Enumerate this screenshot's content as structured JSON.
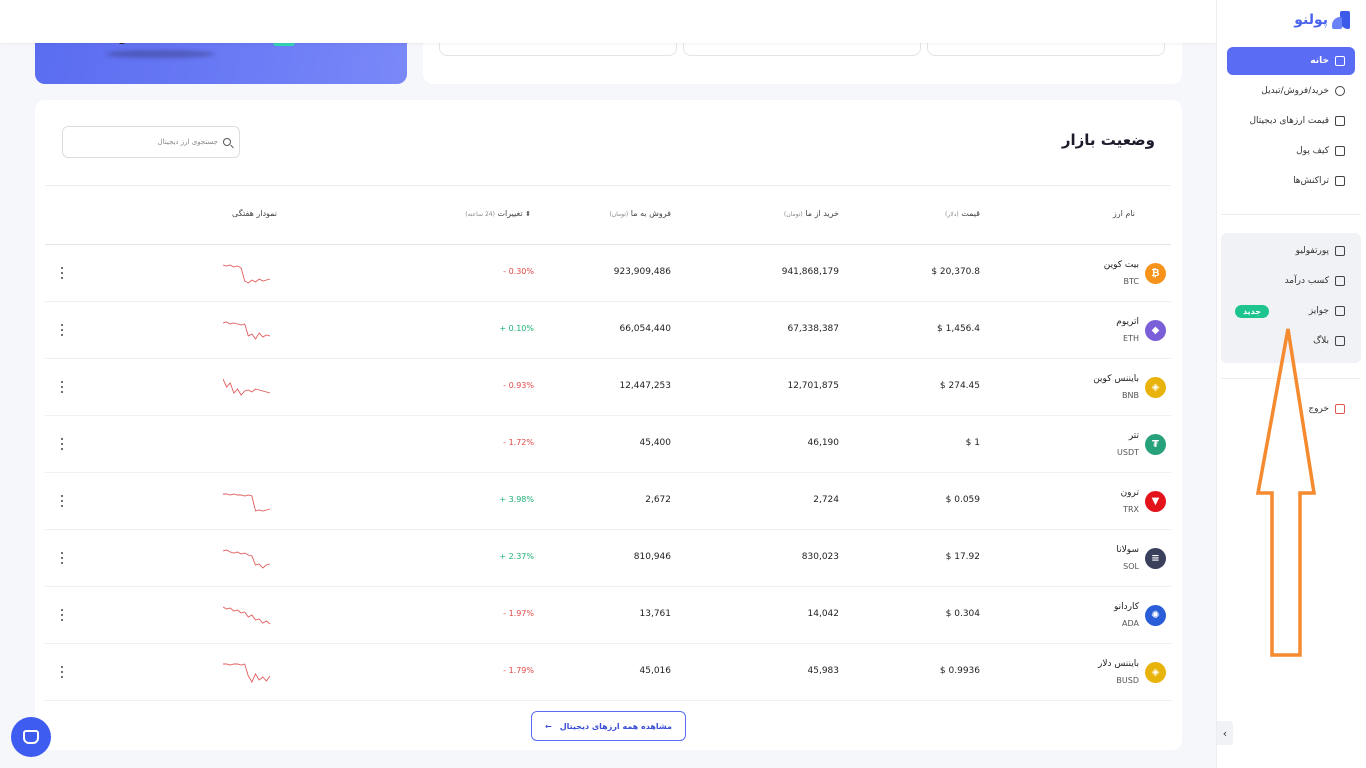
{
  "brand": {
    "name": "پولنو"
  },
  "sidebar": {
    "main_items": [
      {
        "label": "خانه",
        "icon": "home-icon",
        "active": true
      },
      {
        "label": "خرید/فروش/تبدیل",
        "icon": "exchange-icon",
        "active": false
      },
      {
        "label": "قیمت ارزهای دیجیتال",
        "icon": "chart-icon",
        "active": false
      },
      {
        "label": "کیف پول",
        "icon": "wallet-icon",
        "active": false
      },
      {
        "label": "تراکنش‌ها",
        "icon": "receipt-icon",
        "active": false
      }
    ],
    "secondary_items": [
      {
        "label": "پورتفولیو",
        "icon": "portfolio-icon"
      },
      {
        "label": "کسب درآمد",
        "icon": "diamond-icon"
      },
      {
        "label": "جوایز",
        "icon": "gift-icon",
        "badge": "جدید"
      },
      {
        "label": "بلاگ",
        "icon": "rss-icon"
      }
    ],
    "logout": {
      "label": "خروج",
      "icon": "logout-icon"
    },
    "collapse_icon": "chevron-left-icon"
  },
  "market": {
    "title": "وضعیت بازار",
    "search_placeholder": "جستجوی ارز دیجیتال",
    "columns": {
      "name": "نام ارز",
      "price": "قیمت",
      "price_unit": "(دلار)",
      "buy": "خرید از ما",
      "buy_unit": "(تومان)",
      "sell": "فروش به ما",
      "sell_unit": "(تومان)",
      "change": "تغییرات",
      "change_unit": "(24 ساعته)",
      "chart": "نمودار هفتگی"
    },
    "rows": [
      {
        "name": "بیت کوین",
        "symbol": "BTC",
        "price": "$ 20,370.8",
        "buy": "941,868,179",
        "sell": "923,909,486",
        "change": "- 0.30%",
        "direction": "neg",
        "color": "#f7931a",
        "glyph": "₿",
        "spark": [
          2,
          3,
          2,
          4,
          3,
          5,
          18,
          20,
          17,
          19,
          16,
          18,
          17,
          16
        ]
      },
      {
        "name": "اتریوم",
        "symbol": "ETH",
        "price": "$ 1,456.4",
        "buy": "67,338,387",
        "sell": "66,054,440",
        "change": "+ 0.10%",
        "direction": "pos",
        "color": "#7b5fd9",
        "glyph": "◆",
        "spark": [
          3,
          2,
          4,
          3,
          4,
          5,
          4,
          16,
          14,
          19,
          13,
          17,
          15,
          16
        ]
      },
      {
        "name": "بایننس کوین",
        "symbol": "BNB",
        "price": "$ 274.45",
        "buy": "12,701,875",
        "sell": "12,447,253",
        "change": "- 0.93%",
        "direction": "neg",
        "color": "#e8b30b",
        "glyph": "◈",
        "spark": [
          2,
          10,
          6,
          16,
          12,
          18,
          14,
          13,
          15,
          12,
          13,
          14,
          15,
          16
        ]
      },
      {
        "name": "تتر",
        "symbol": "USDT",
        "price": "$ 1",
        "buy": "46,190",
        "sell": "45,400",
        "change": "- 1.72%",
        "direction": "neg",
        "color": "#26a17b",
        "glyph": "₮",
        "spark": []
      },
      {
        "name": "ترون",
        "symbol": "TRX",
        "price": "$ 0.059",
        "buy": "2,724",
        "sell": "2,672",
        "change": "+ 3.98%",
        "direction": "pos",
        "color": "#e3131c",
        "glyph": "▼",
        "spark": [
          3,
          3,
          4,
          3,
          4,
          4,
          5,
          4,
          5,
          20,
          19,
          20,
          19,
          18
        ]
      },
      {
        "name": "سولانا",
        "symbol": "SOL",
        "price": "$ 17.92",
        "buy": "830,023",
        "sell": "810,946",
        "change": "+ 2.37%",
        "direction": "pos",
        "color": "#3a3f5c",
        "glyph": "≡",
        "spark": [
          3,
          2,
          4,
          5,
          4,
          6,
          5,
          7,
          8,
          17,
          16,
          20,
          17,
          16
        ]
      },
      {
        "name": "کاردانو",
        "symbol": "ADA",
        "price": "$ 0.304",
        "buy": "14,042",
        "sell": "13,761",
        "change": "- 1.97%",
        "direction": "neg",
        "color": "#2a5ed9",
        "glyph": "✺",
        "spark": [
          2,
          4,
          3,
          6,
          5,
          8,
          7,
          12,
          10,
          15,
          14,
          18,
          16,
          19
        ]
      },
      {
        "name": "بایننس دلار",
        "symbol": "BUSD",
        "price": "$ 0.9936",
        "buy": "45,983",
        "sell": "45,016",
        "change": "- 1.79%",
        "direction": "neg",
        "color": "#e8b30b",
        "glyph": "◈",
        "spark": [
          2,
          2,
          3,
          2,
          2,
          3,
          2,
          14,
          20,
          12,
          18,
          15,
          19,
          14
        ]
      }
    ],
    "view_all_label": "مشاهده همه ارزهای دیجیتال"
  }
}
